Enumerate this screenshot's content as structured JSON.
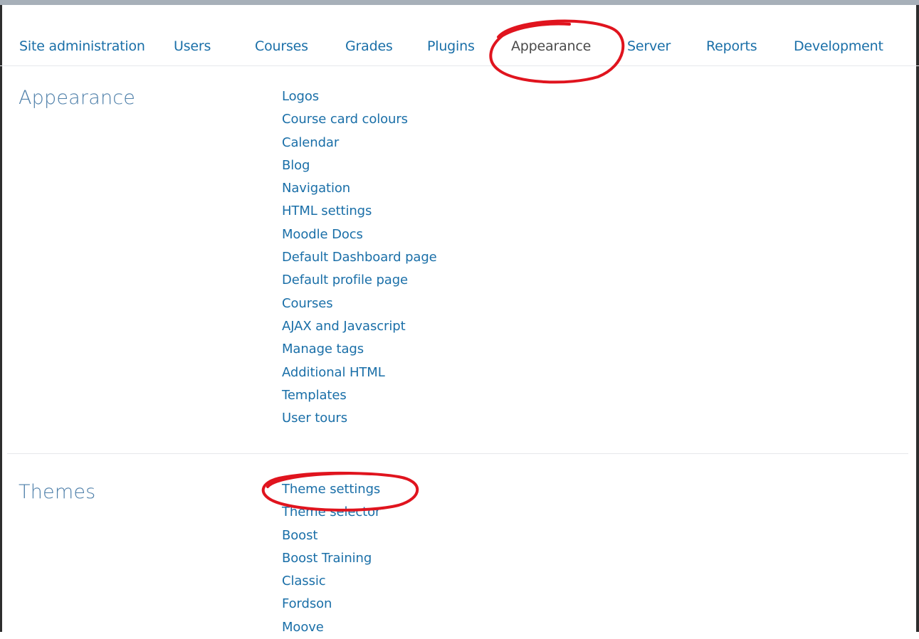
{
  "nav": {
    "items": [
      {
        "label": "Site administration"
      },
      {
        "label": "Users"
      },
      {
        "label": "Courses"
      },
      {
        "label": "Grades"
      },
      {
        "label": "Plugins"
      },
      {
        "label": "Appearance"
      },
      {
        "label": "Server"
      },
      {
        "label": "Reports"
      },
      {
        "label": "Development"
      }
    ],
    "active": "Appearance"
  },
  "sections": [
    {
      "title": "Appearance",
      "links": [
        "Logos",
        "Course card colours",
        "Calendar",
        "Blog",
        "Navigation",
        "HTML settings",
        "Moodle Docs",
        "Default Dashboard page",
        "Default profile page",
        "Courses",
        "AJAX and Javascript",
        "Manage tags",
        "Additional HTML",
        "Templates",
        "User tours"
      ]
    },
    {
      "title": "Themes",
      "links": [
        "Theme settings",
        "Theme selector",
        "Boost",
        "Boost Training",
        "Classic",
        "Fordson",
        "Moove"
      ]
    }
  ],
  "colors": {
    "link": "#1a6fa8",
    "heading": "#4e7fa9",
    "annotation": "#e0141e"
  }
}
